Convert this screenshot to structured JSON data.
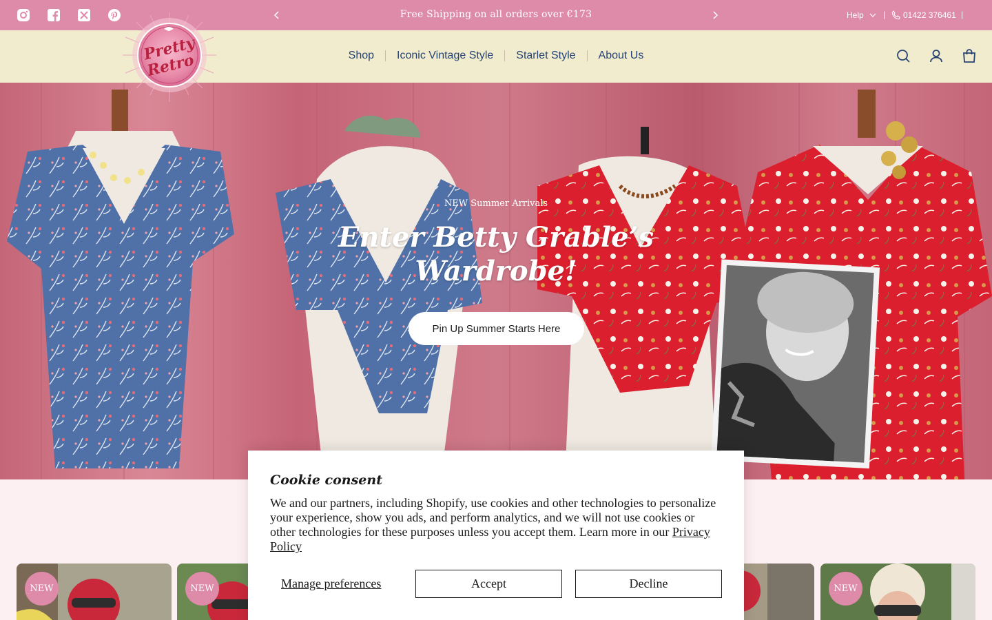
{
  "topbar": {
    "social_icons": [
      "instagram-icon",
      "facebook-icon",
      "x-icon",
      "pinterest-icon"
    ],
    "announcement": "Free Shipping on all orders over €173",
    "help_label": "Help",
    "separator": "|",
    "phone": "01422 376461"
  },
  "header": {
    "logo_text": [
      "Pretty",
      "Retro"
    ],
    "nav": [
      "Shop",
      "Iconic Vintage Style",
      "Starlet Style",
      "About Us"
    ],
    "icons": [
      "search-icon",
      "account-icon",
      "cart-icon"
    ]
  },
  "hero": {
    "kicker": "NEW Summer Arrivals",
    "title": "Enter Betty Grable’s Wardrobe!",
    "button_label": "Pin Up Summer Starts Here"
  },
  "products": {
    "badge_label": "NEW"
  },
  "cookie": {
    "title": "Cookie consent",
    "body": "We and our partners, including Shopify, use cookies and other technologies to personalize your experience, show you ads, and perform analytics, and we will not use cookies or other technologies for these purposes unless you accept them. Learn more in our",
    "privacy_link": "Privacy Policy",
    "manage_label": "Manage preferences",
    "accept_label": "Accept",
    "decline_label": "Decline"
  },
  "colors": {
    "topbar": "#de8aa9",
    "header": "#f2ecce",
    "nav_text": "#264473",
    "page_bg": "#fdf0f2"
  }
}
